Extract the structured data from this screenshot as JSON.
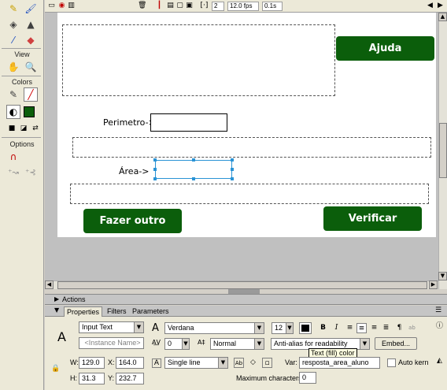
{
  "tools_panel": {
    "view_label": "View",
    "colors_label": "Colors",
    "options_label": "Options"
  },
  "timeline": {
    "current_frame": "2",
    "fps": "12.0 fps",
    "elapsed": "0.1s"
  },
  "stage": {
    "help_button": "Ajuda",
    "perimeter_label": "Perimetro->",
    "area_label": "Área->",
    "new_button": "Fazer outro",
    "verify_button": "Verificar",
    "button_color": "#0b5e0b"
  },
  "panels": {
    "actions_label": "Actions",
    "tabs": [
      "Properties",
      "Filters",
      "Parameters"
    ]
  },
  "properties": {
    "text_type": "Input Text",
    "instance_name_placeholder": "<Instance Name>",
    "font": "Verdana",
    "font_size": "12",
    "letter_spacing": "0",
    "baseline": "Normal",
    "anti_alias": "Anti-alias for readability",
    "embed_button": "Embed...",
    "line_type": "Single line",
    "var_label": "Var:",
    "var_value": "resposta_area_aluno",
    "auto_kern_label": "Auto kern",
    "max_chars_label": "Maximum characters:",
    "max_chars_value": "0",
    "w_label": "W:",
    "w_value": "129.0",
    "h_label": "H:",
    "h_value": "31.3",
    "x_label": "X:",
    "x_value": "164.0",
    "y_label": "Y:",
    "y_value": "232.7",
    "tooltip": "Text (fill) color",
    "fill_color": "#000000"
  }
}
